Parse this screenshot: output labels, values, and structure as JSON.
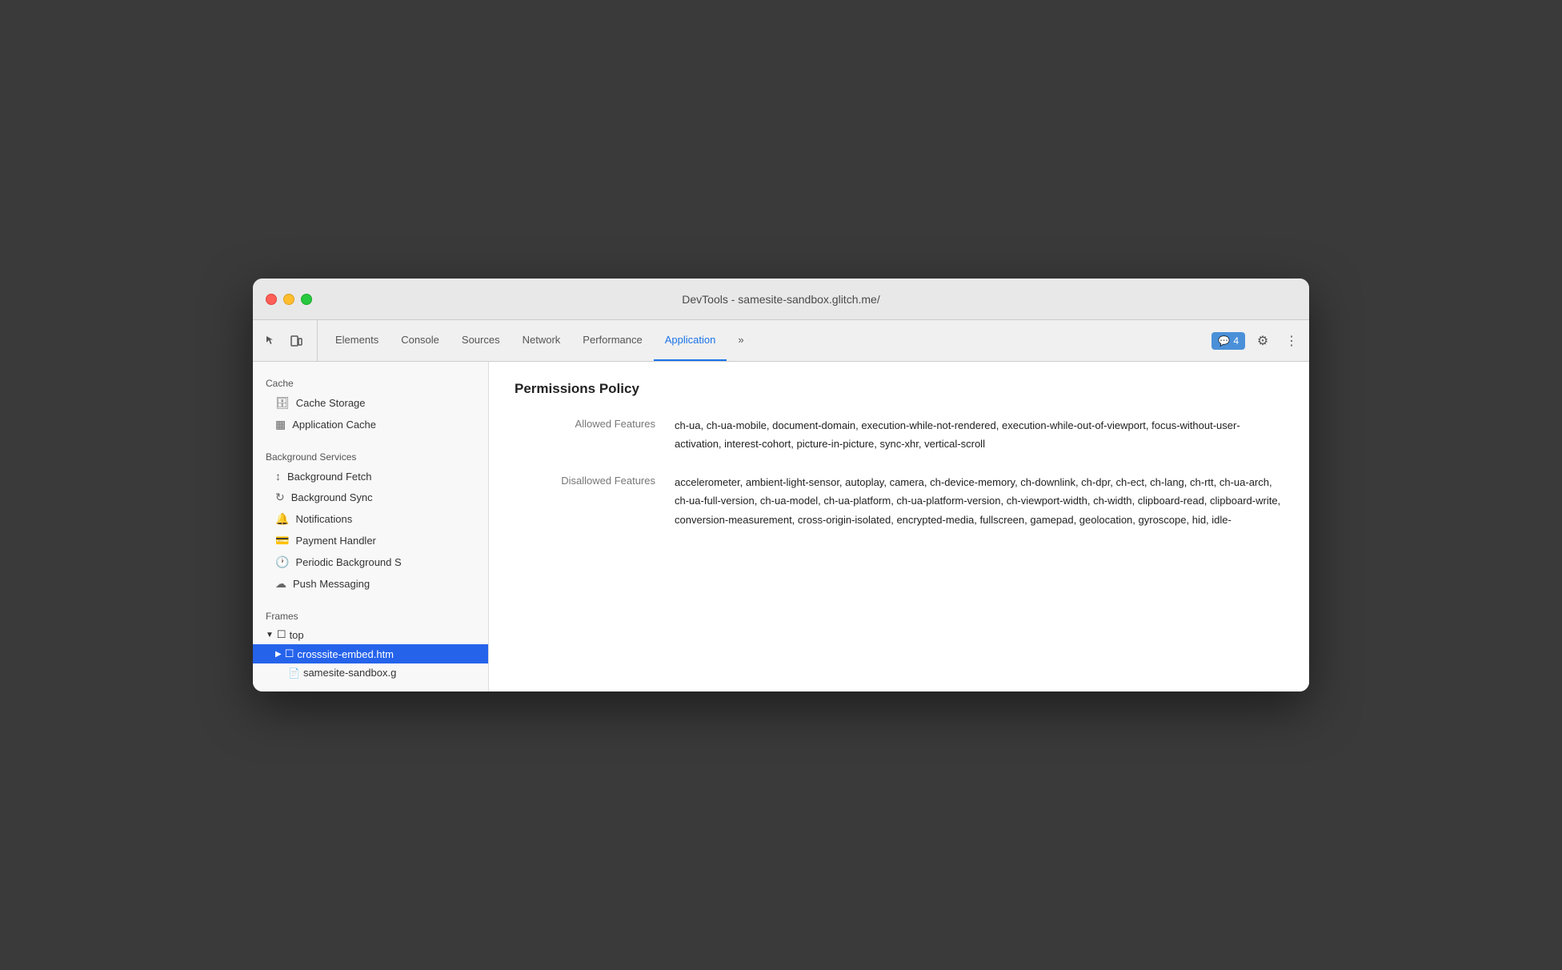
{
  "window": {
    "title": "DevTools - samesite-sandbox.glitch.me/"
  },
  "tabs": [
    {
      "label": "Elements",
      "active": false
    },
    {
      "label": "Console",
      "active": false
    },
    {
      "label": "Sources",
      "active": false
    },
    {
      "label": "Network",
      "active": false
    },
    {
      "label": "Performance",
      "active": false
    },
    {
      "label": "Application",
      "active": true
    }
  ],
  "toolbar": {
    "more_tabs": "»",
    "badge_count": "4",
    "gear_icon": "⚙",
    "dots_icon": "⋮"
  },
  "sidebar": {
    "cache_section": "Cache",
    "cache_storage_label": "Cache Storage",
    "application_cache_label": "Application Cache",
    "background_services_section": "Background Services",
    "background_fetch_label": "Background Fetch",
    "background_sync_label": "Background Sync",
    "notifications_label": "Notifications",
    "payment_handler_label": "Payment Handler",
    "periodic_background_label": "Periodic Background S",
    "push_messaging_label": "Push Messaging",
    "frames_section": "Frames",
    "top_label": "top",
    "crosssite_label": "crosssite-embed.htm",
    "samesite_label": "samesite-sandbox.g"
  },
  "content": {
    "title": "Permissions Policy",
    "allowed_label": "Allowed Features",
    "allowed_value": "ch-ua, ch-ua-mobile, document-domain, execution-while-not-rendered, execution-while-out-of-viewport, focus-without-user-activation, interest-cohort, picture-in-picture, sync-xhr, vertical-scroll",
    "disallowed_label": "Disallowed Features",
    "disallowed_value": "accelerometer, ambient-light-sensor, autoplay, camera, ch-device-memory, ch-downlink, ch-dpr, ch-ect, ch-lang, ch-rtt, ch-ua-arch, ch-ua-full-version, ch-ua-model, ch-ua-platform, ch-ua-platform-version, ch-viewport-width, ch-width, clipboard-read, clipboard-write, conversion-measurement, cross-origin-isolated, encrypted-media, fullscreen, gamepad, geolocation, gyroscope, hid, idle-"
  }
}
